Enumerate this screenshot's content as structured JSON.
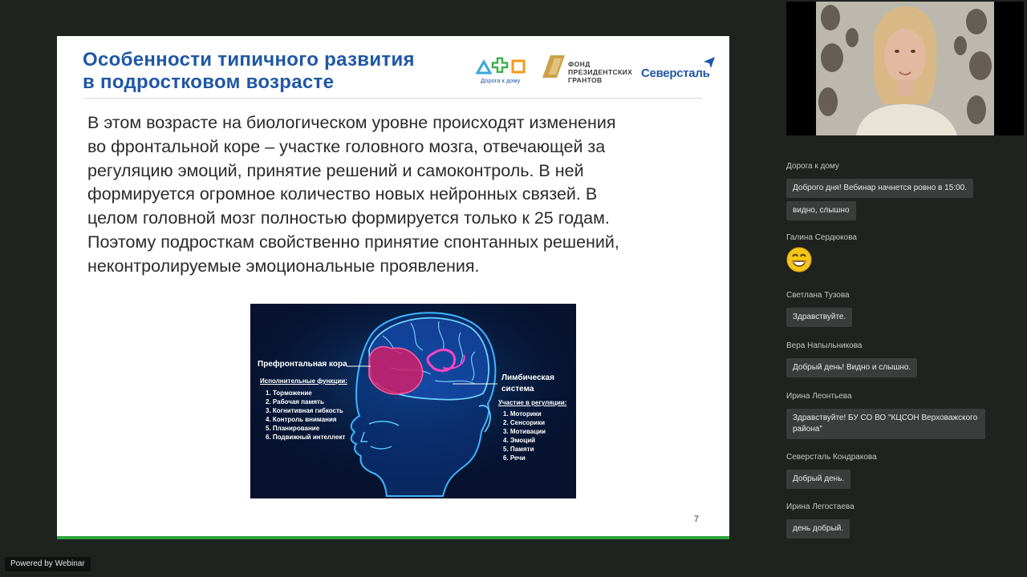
{
  "slide": {
    "title_line1": "Особенности типичного развития",
    "title_line2": "в подростковом возрасте",
    "logos": {
      "doroga": "Дорога к дому",
      "fond": "ФОНД\nПРЕЗИДЕНТСКИХ\nГРАНТОВ",
      "severstal": "Северсталь"
    },
    "body_lines": [
      "В этом возрасте на биологическом уровне происходят изменения",
      "во фронтальной коре – участке головного мозга, отвечающей за",
      "регуляцию эмоций, принятие решений и самоконтроль. В ней",
      "формируется огромное количество новых нейронных связей. В",
      "целом головной мозг полностью формируется только к 25 годам.",
      "Поэтому подросткам свойственно принятие спонтанных решений,",
      "неконтролируемые эмоциональные проявления."
    ],
    "image": {
      "left_title": "Префронтальная кора",
      "left_sub": "Исполнительные функции:",
      "left_items": [
        "1. Торможение",
        "2. Рабочая память",
        "3. Когнитивная гибкость",
        "4. Контроль внимания",
        "5. Планирование",
        "6. Подвижный интеллект"
      ],
      "right_title1": "Лимбическая",
      "right_title2": "система",
      "right_sub": "Участие в регуляции:",
      "right_items": [
        "1. Моторики",
        "2. Сенсорики",
        "3. Мотивации",
        "4. Эмоций",
        "5. Памяти",
        "6. Речи"
      ]
    },
    "page_number": "7"
  },
  "chat": {
    "messages": [
      {
        "sender": "Дорога к дому",
        "texts": [
          "Доброго дня! Вебинар начнется ровно в 15:00.",
          "видно, слышно"
        ]
      },
      {
        "sender": "Галина Сердюкова",
        "emoji": "smiling-face"
      },
      {
        "sender": "Светлана Тузова",
        "texts": [
          "Здравствуйте."
        ]
      },
      {
        "sender": "Вера Напыльникова",
        "texts": [
          "Добрый день! Видно и слышно."
        ]
      },
      {
        "sender": "Ирина Леонтьева",
        "texts": [
          "Здравствуйте! БУ СО ВО \"КЦСОН Верховажского района\""
        ]
      },
      {
        "sender": "Северсталь Кондракова",
        "texts": [
          "Добрый день."
        ]
      },
      {
        "sender": "Ирина Легостаева",
        "texts": [
          "день добрый."
        ]
      }
    ]
  },
  "footer": {
    "powered_by": "Powered by Webinar"
  },
  "colors": {
    "accent_blue": "#1f57a4",
    "slide_bar_green": "#2aa33a",
    "bubble_bg": "#3a3d3b",
    "page_bg": "#1e2320"
  }
}
